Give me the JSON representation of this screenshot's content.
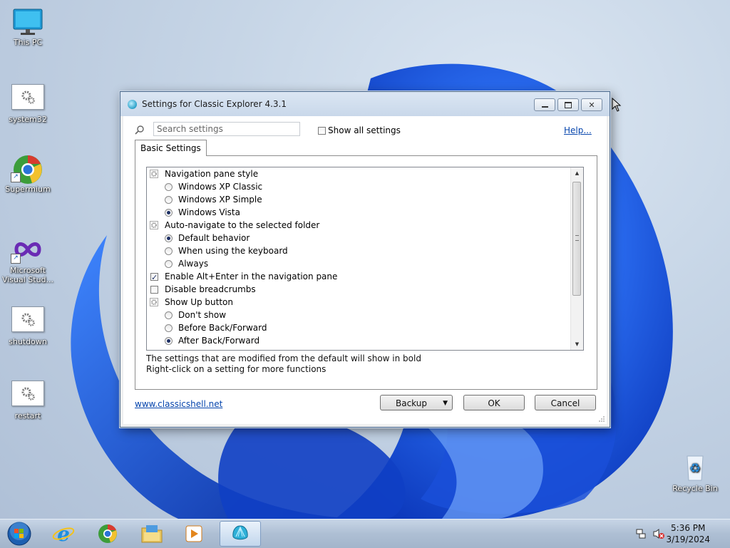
{
  "desktop": {
    "icons": [
      {
        "label": "This PC"
      },
      {
        "label": "system32"
      },
      {
        "label": "Supermium"
      },
      {
        "label": "Microsoft Visual Stud..."
      },
      {
        "label": "shutdown"
      },
      {
        "label": "restart"
      },
      {
        "label": "Recycle Bin"
      }
    ]
  },
  "dialog": {
    "title": "Settings for Classic Explorer 4.3.1",
    "search_placeholder": "Search settings",
    "show_all_label": "Show all settings",
    "show_all_checked": false,
    "help_label": "Help...",
    "tab_label": "Basic Settings",
    "settings": [
      {
        "type": "group",
        "label": "Navigation pane style"
      },
      {
        "type": "radio",
        "label": "Windows XP Classic",
        "checked": false
      },
      {
        "type": "radio",
        "label": "Windows XP Simple",
        "checked": false
      },
      {
        "type": "radio",
        "label": "Windows Vista",
        "checked": true
      },
      {
        "type": "group",
        "label": "Auto-navigate to the selected folder"
      },
      {
        "type": "radio",
        "label": "Default behavior",
        "checked": true
      },
      {
        "type": "radio",
        "label": "When using the keyboard",
        "checked": false
      },
      {
        "type": "radio",
        "label": "Always",
        "checked": false
      },
      {
        "type": "check",
        "label": "Enable Alt+Enter in the navigation pane",
        "checked": true
      },
      {
        "type": "check",
        "label": "Disable breadcrumbs",
        "checked": false
      },
      {
        "type": "group",
        "label": "Show Up button"
      },
      {
        "type": "radio",
        "label": "Don't show",
        "checked": false
      },
      {
        "type": "radio",
        "label": "Before Back/Forward",
        "checked": false
      },
      {
        "type": "radio",
        "label": "After Back/Forward",
        "checked": true
      }
    ],
    "info_line1": "The settings that are modified from the default will show in bold",
    "info_line2": "Right-click on a setting for more functions",
    "footer_link": "www.classicshell.net",
    "backup_label": "Backup",
    "ok_label": "OK",
    "cancel_label": "Cancel"
  },
  "taskbar": {
    "time": "5:36 PM",
    "date": "3/19/2024",
    "apps": [
      "start-orb",
      "internet-explorer",
      "supermium",
      "file-explorer",
      "media-player",
      "classic-explorer-settings"
    ]
  },
  "colors": {
    "wallpaper_blue": "#1f5fe0",
    "link": "#0645ad",
    "taskbar": "#aebfd4"
  }
}
